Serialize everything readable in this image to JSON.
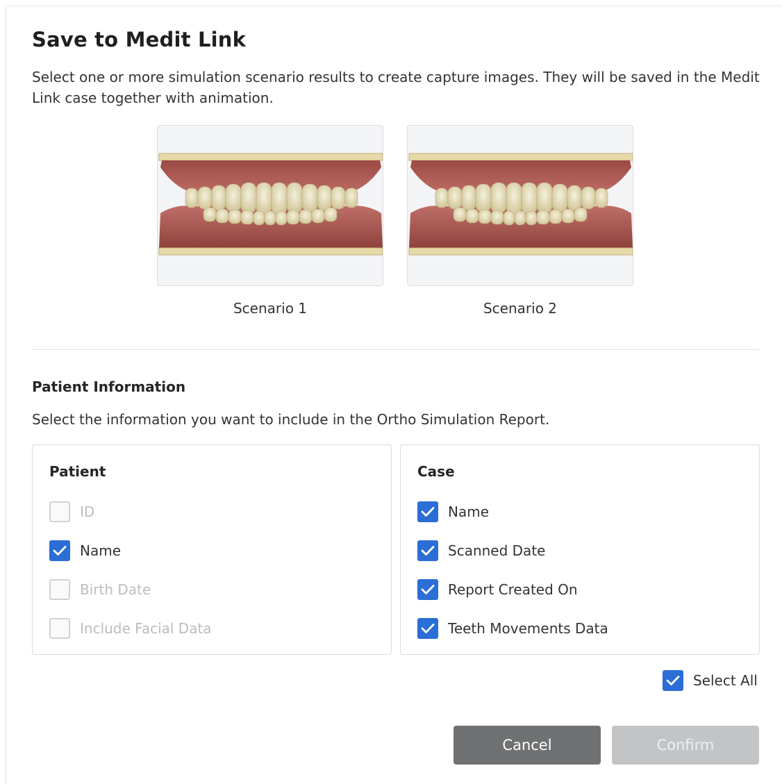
{
  "dialog": {
    "title": "Save to Medit Link",
    "description": "Select one or more simulation scenario results to create capture images. They will be saved in the Medit Link case together with animation."
  },
  "scenarios": [
    {
      "label": "Scenario 1"
    },
    {
      "label": "Scenario 2"
    }
  ],
  "patient_information": {
    "title": "Patient Information",
    "description": "Select the information you want to include in the Ortho Simulation Report."
  },
  "patient_panel": {
    "title": "Patient",
    "items": [
      {
        "label": "ID",
        "checked": false,
        "disabled": true
      },
      {
        "label": "Name",
        "checked": true,
        "disabled": false
      },
      {
        "label": "Birth Date",
        "checked": false,
        "disabled": true
      },
      {
        "label": "Include Facial Data",
        "checked": false,
        "disabled": true
      }
    ]
  },
  "case_panel": {
    "title": "Case",
    "items": [
      {
        "label": "Name",
        "checked": true,
        "disabled": false
      },
      {
        "label": "Scanned Date",
        "checked": true,
        "disabled": false
      },
      {
        "label": "Report Created On",
        "checked": true,
        "disabled": false
      },
      {
        "label": "Teeth Movements Data",
        "checked": true,
        "disabled": false
      }
    ]
  },
  "select_all": {
    "label": "Select All",
    "checked": true
  },
  "buttons": {
    "cancel": "Cancel",
    "confirm": "Confirm"
  },
  "colors": {
    "checkbox_checked": "#2a6ed6",
    "cancel_button": "#6f7173",
    "confirm_button_disabled": "#c2c4c6"
  }
}
